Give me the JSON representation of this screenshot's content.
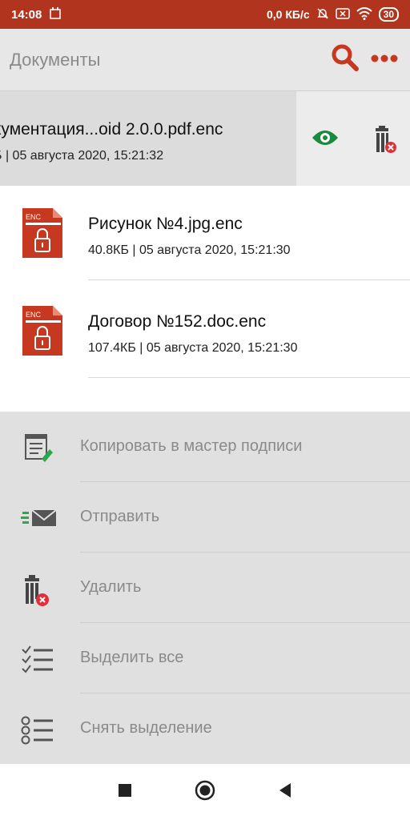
{
  "status": {
    "time": "14:08",
    "speed": "0,0 КБ/с",
    "battery": "30"
  },
  "appbar": {
    "title": "Документы",
    "search_icon": "search-icon",
    "more_icon": "more-dots-icon"
  },
  "colors": {
    "accent": "#b0341e",
    "eye": "#1a8a3c",
    "delete_badge": "#e0303a"
  },
  "files": [
    {
      "name": "кументация...oid 2.0.0.pdf.enc",
      "meta": "Б | 05 августа 2020, 15:21:32",
      "swiped": true
    },
    {
      "name": "Рисунок №4.jpg.enc",
      "meta": "40.8КБ | 05 августа 2020, 15:21:30",
      "icon_label": "ENC"
    },
    {
      "name": "Договор №152.doc.enc",
      "meta": "107.4КБ | 05 августа 2020, 15:21:30",
      "icon_label": "ENC"
    }
  ],
  "sheet": {
    "items": [
      {
        "label": "Копировать в мастер подписи",
        "icon": "sign-master-icon"
      },
      {
        "label": "Отправить",
        "icon": "send-mail-icon"
      },
      {
        "label": "Удалить",
        "icon": "delete-icon"
      },
      {
        "label": "Выделить все",
        "icon": "select-all-icon"
      },
      {
        "label": "Снять выделение",
        "icon": "deselect-icon"
      }
    ]
  }
}
